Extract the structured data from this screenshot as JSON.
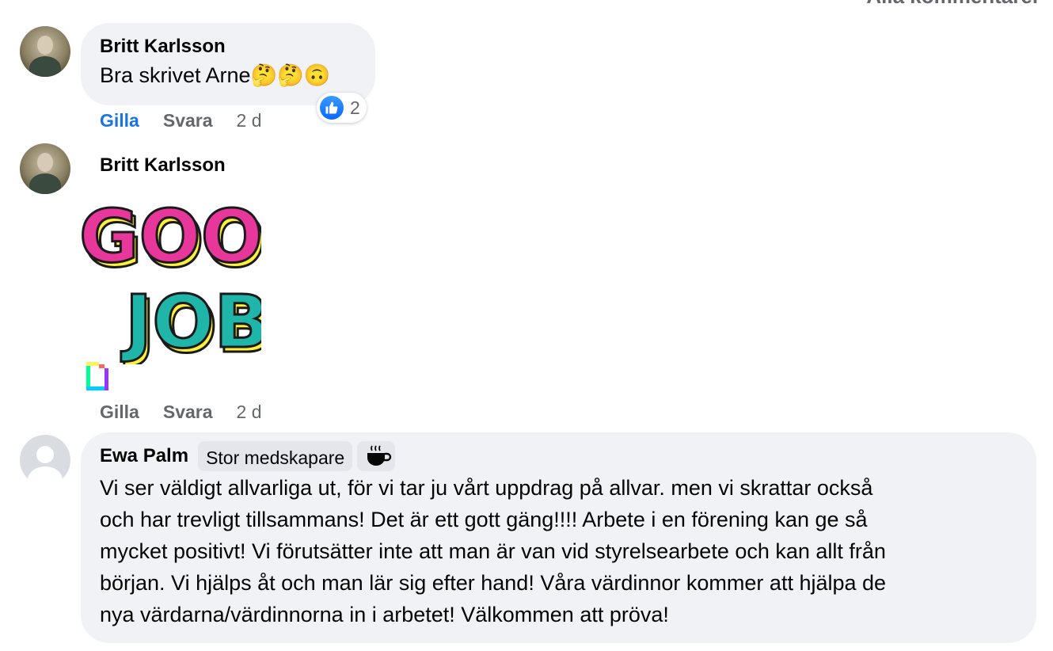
{
  "header": {
    "all_comments_label": "Alla kommentarer"
  },
  "comments": [
    {
      "author": "Britt Karlsson",
      "text": "Bra skrivet Arne🤔🤔🙃",
      "reaction_count": "2",
      "actions": {
        "like": "Gilla",
        "reply": "Svara",
        "time": "2 d"
      }
    },
    {
      "author": "Britt Karlsson",
      "gif": {
        "line1": "GOOD",
        "line2": "JOB!"
      },
      "actions": {
        "like": "Gilla",
        "reply": "Svara",
        "time": "2 d"
      }
    },
    {
      "author": "Ewa Palm",
      "badge": "Stor medskapare",
      "badge_icon": "coffee-cup-icon",
      "text_lines": [
        "Vi ser väldigt allvarliga ut, för vi tar ju vårt uppdrag på allvar. men vi skrattar också",
        "och har trevligt tillsammans! Det är ett gott gäng!!!! Arbete i en förening kan ge så",
        "mycket positivt! Vi förutsätter inte att man är van vid styrelsearbete och kan allt från",
        "början. Vi hjälps åt och man lär sig efter hand! Våra värdinnor kommer att hjälpa de",
        "nya värdarna/värdinnorna in i arbetet! Välkommen att pröva!"
      ]
    }
  ],
  "colors": {
    "bubble": "#f0f2f5",
    "liked": "#1b74e4",
    "muted": "#65676b",
    "gif_pink": "#e8379b",
    "gif_teal": "#1fb5a8",
    "gif_yellow": "#fff03a"
  }
}
